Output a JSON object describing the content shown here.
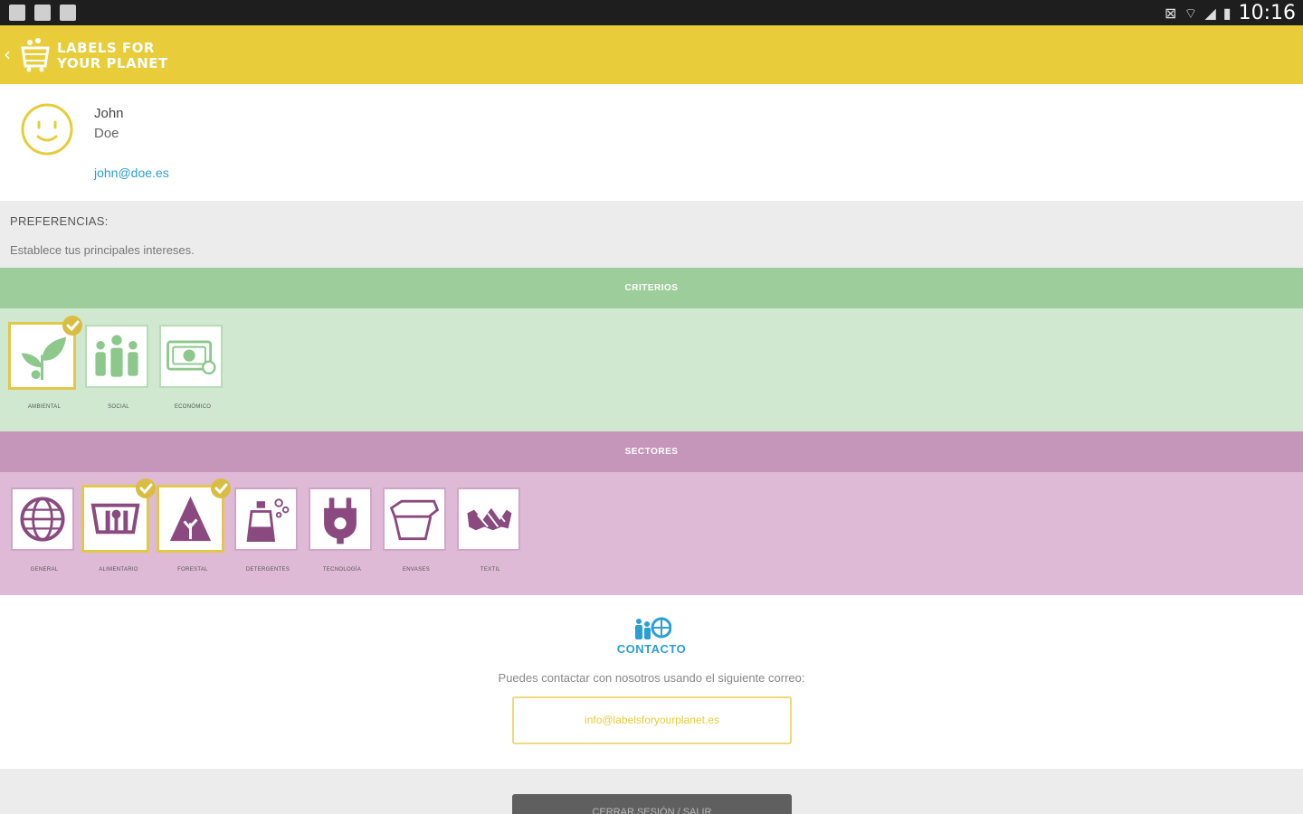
{
  "status_bar": {
    "left_icons": [
      "notification-icon",
      "image-icon",
      "bag-icon"
    ],
    "right_icons": [
      "mute-icon",
      "wifi-icon",
      "signal-icon",
      "battery-icon"
    ],
    "time": "10:16"
  },
  "app_bar": {
    "brand_line1": "LABELS FOR",
    "brand_line2": "YOUR PLANET"
  },
  "profile": {
    "first_name": "John",
    "last_name": "Doe",
    "email": "john@doe.es"
  },
  "preferences": {
    "title": "PREFERENCIAS:",
    "subtitle": "Establece tus principales intereses."
  },
  "criterios": {
    "header": "CRITERIOS",
    "items": [
      {
        "label": "AMBIENTAL",
        "icon": "leaf-icon",
        "selected": true
      },
      {
        "label": "SOCIAL",
        "icon": "people-icon",
        "selected": false
      },
      {
        "label": "ECONÓMICO",
        "icon": "money-icon",
        "selected": false
      }
    ]
  },
  "sectores": {
    "header": "SECTORES",
    "items": [
      {
        "label": "GENERAL",
        "icon": "globe-icon",
        "selected": false
      },
      {
        "label": "ALIMENTARIO",
        "icon": "food-icon",
        "selected": true
      },
      {
        "label": "FORESTAL",
        "icon": "tree-icon",
        "selected": true
      },
      {
        "label": "DETERGENTES",
        "icon": "detergent-icon",
        "selected": false
      },
      {
        "label": "TECNOLOGÍA",
        "icon": "plug-icon",
        "selected": false
      },
      {
        "label": "ENVASES",
        "icon": "container-icon",
        "selected": false
      },
      {
        "label": "TEXTIL",
        "icon": "textile-icon",
        "selected": false
      }
    ]
  },
  "contact": {
    "title": "CONTACTO",
    "text": "Puedes contactar con nosotros usando el siguiente correo:",
    "email": "info@labelsforyourplanet.es"
  },
  "bottom_button": {
    "label": "CERRAR SESIÓN / SALIR"
  },
  "colors": {
    "brand_yellow": "#e8cc3a",
    "criterios_green": "#9ccd9b",
    "sectores_purple": "#c596b9",
    "link_blue": "#2a9fd6",
    "icon_purple": "#8a4a7f"
  }
}
